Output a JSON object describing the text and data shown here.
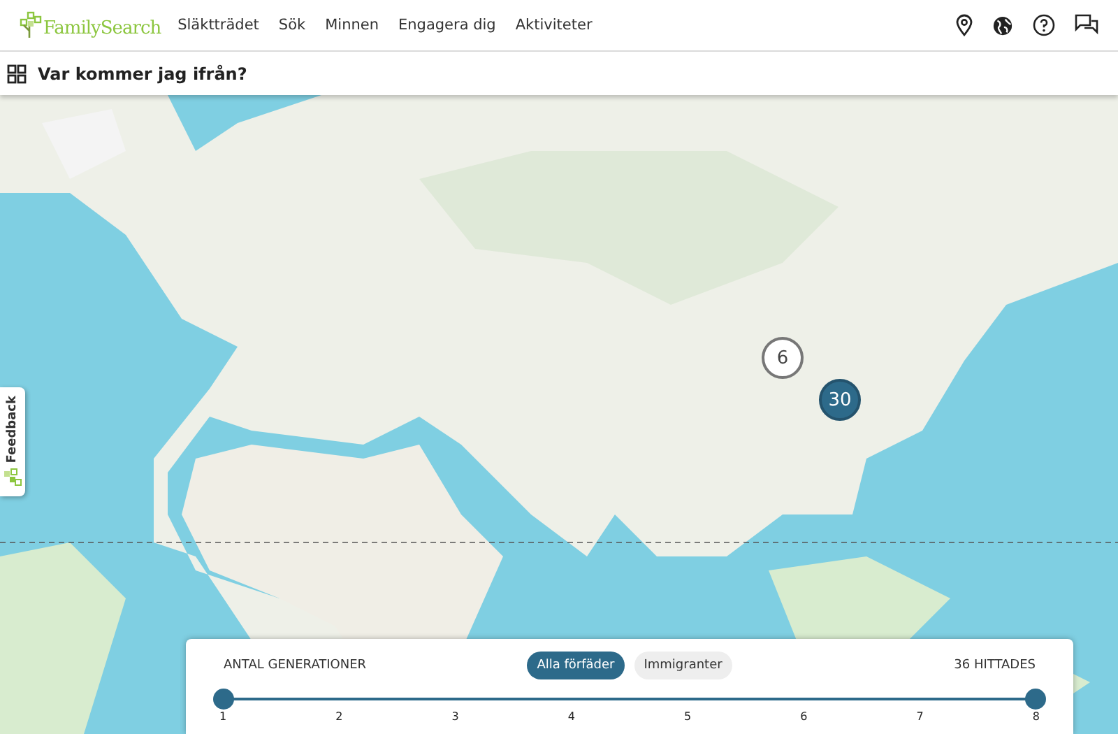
{
  "header": {
    "logo": "FamilySearch",
    "nav": [
      "Släktträdet",
      "Sök",
      "Minnen",
      "Engagera dig",
      "Aktiviteter"
    ]
  },
  "title_bar": {
    "title": "Var kommer jag ifrån?"
  },
  "map": {
    "clusters": [
      {
        "count": "6",
        "selected": false
      },
      {
        "count": "30",
        "selected": true
      }
    ]
  },
  "feedback_tab": {
    "label": "Feedback"
  },
  "panel": {
    "label": "ANTAL GENERATIONER",
    "filters": [
      {
        "label": "Alla förfäder",
        "selected": true
      },
      {
        "label": "Immigranter",
        "selected": false
      }
    ],
    "found": "36 HITTADES",
    "slider": {
      "thumbs": [
        {
          "level": 0
        },
        {
          "level": 1
        }
      ],
      "ticks": [
        "1",
        "2",
        "3",
        "4",
        "5",
        "6",
        "7",
        "8"
      ]
    }
  }
}
